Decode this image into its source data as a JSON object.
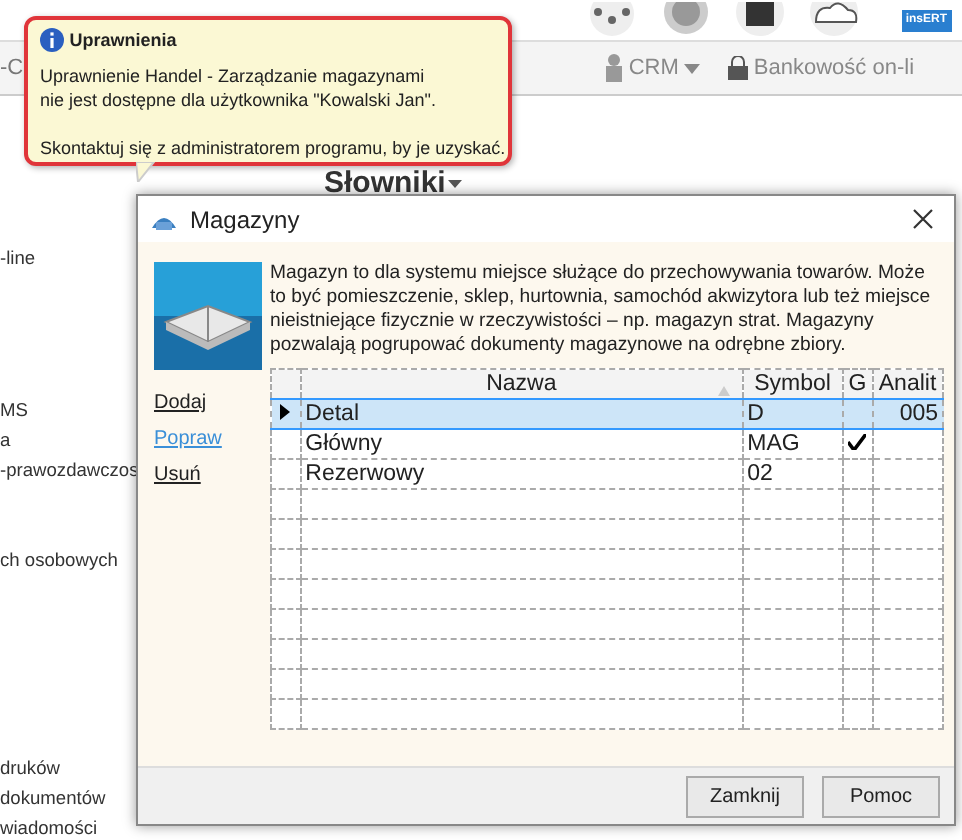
{
  "app_toolbar": {
    "logo": "insERT",
    "left_fragment": "-C",
    "crm_menu": "CRM",
    "banking_link": "Bankowość on-li"
  },
  "section_title": "Słowniki",
  "sidebar_items": [
    {
      "label": "-line"
    },
    {
      "label": "MS"
    },
    {
      "label": "a"
    },
    {
      "label": "-prawozdawczos"
    },
    {
      "label": "ch osobowych"
    },
    {
      "label": "druków"
    },
    {
      "label": "dokumentów"
    },
    {
      "label": "wiadomości"
    }
  ],
  "tooltip": {
    "title": "Uprawnienia",
    "message": "Uprawnienie Handel - Zarządzanie magazynami\nnie jest dostępne dla użytkownika \"Kowalski Jan\".",
    "hint": "Skontaktuj się z administratorem programu, by je uzyskać."
  },
  "dialog": {
    "title": "Magazyny",
    "description": "Magazyn to dla systemu miejsce służące do przechowywania towarów. Może to być pomieszczenie, sklep, hurtownia, samochód akwizytora lub też miejsce nieistniejące fizycznie w rzeczywistości – np. magazyn strat. Magazyny pozwalają pogrupować dokumenty magazynowe na odrębne zbiory.",
    "actions": [
      {
        "label": "Dodaj",
        "hovered": false
      },
      {
        "label": "Popraw",
        "hovered": true
      },
      {
        "label": "Usuń",
        "hovered": false
      }
    ],
    "table": {
      "columns": [
        {
          "label": "Nazwa",
          "sorted": true
        },
        {
          "label": "Symbol",
          "sorted": false
        },
        {
          "label": "G",
          "sorted": false
        },
        {
          "label": "Analit",
          "sorted": false
        }
      ],
      "rows": [
        {
          "name": "Detal",
          "symbol": "D",
          "checked": false,
          "analit": "005",
          "selected": true
        },
        {
          "name": "Główny",
          "symbol": "MAG",
          "checked": true,
          "selected": false
        },
        {
          "name": "Rezerwowy",
          "symbol": "02",
          "checked": false,
          "selected": false
        }
      ]
    },
    "buttons": [
      "Zamknij",
      "Pomoc"
    ]
  }
}
